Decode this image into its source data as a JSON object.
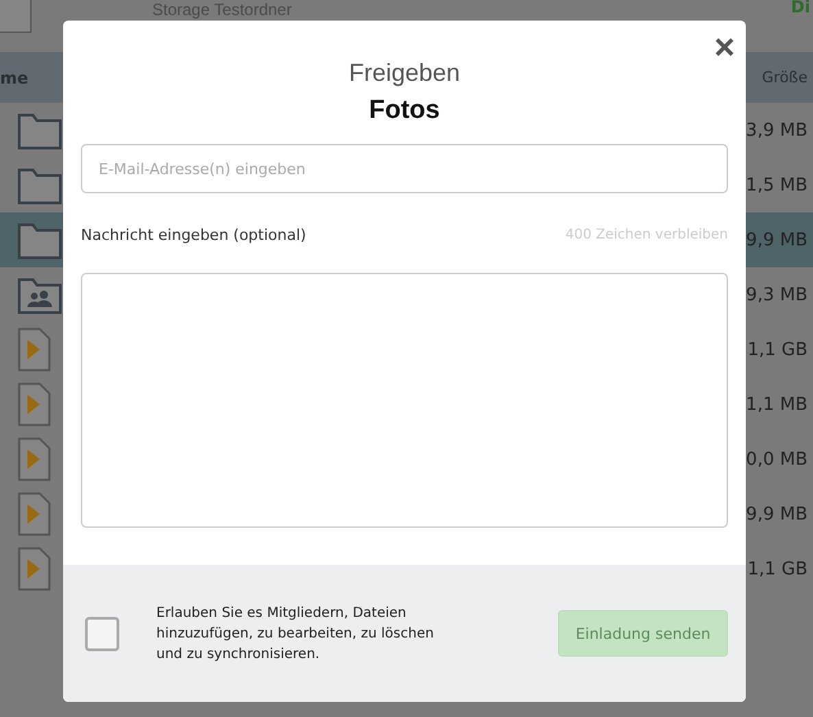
{
  "background": {
    "folder_title": "Storage Testordner",
    "column_name": "me",
    "column_size": "Größe",
    "top_right": "Di",
    "rows": [
      {
        "kind": "folder",
        "size": "3,9 MB",
        "selected": false
      },
      {
        "kind": "folder",
        "size": "1,5 MB",
        "selected": false
      },
      {
        "kind": "folder",
        "size": "9,9 MB",
        "selected": true
      },
      {
        "kind": "shared",
        "size": "9,3 MB",
        "selected": false
      },
      {
        "kind": "video",
        "size": "1,1 GB",
        "selected": false
      },
      {
        "kind": "video",
        "size": "1,1 MB",
        "selected": false
      },
      {
        "kind": "video",
        "size": "0,0 MB",
        "selected": false
      },
      {
        "kind": "video",
        "size": "9,9 MB",
        "selected": false
      },
      {
        "kind": "video",
        "size": "1,1 GB",
        "selected": false
      }
    ]
  },
  "dialog": {
    "title": "Freigeben",
    "subtitle": "Fotos",
    "close": "×",
    "email": {
      "placeholder": "E-Mail-Adresse(n) eingeben"
    },
    "message_label": "Nachricht eingeben (optional)",
    "remaining": "400 Zeichen verbleiben",
    "permission": {
      "label": "Erlauben Sie es Mitgliedern, Dateien hinzuzufügen, zu bearbeiten, zu löschen und zu synchronisieren.",
      "checked": false
    },
    "send_button": {
      "label": "Einladung senden",
      "disabled": true
    }
  }
}
